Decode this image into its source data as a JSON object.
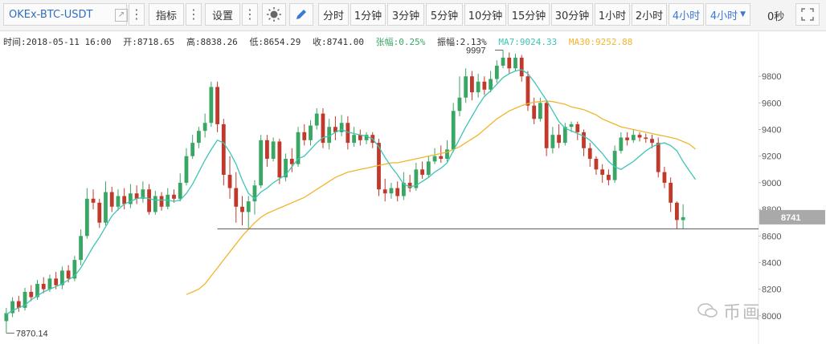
{
  "toolbar": {
    "symbol": "OKEx-BTC-USDT",
    "indicator_label": "指标",
    "settings_label": "设置",
    "intervals": [
      "分时",
      "1分钟",
      "3分钟",
      "5分钟",
      "10分钟",
      "15分钟",
      "30分钟",
      "1小时",
      "2小时",
      "4小时",
      "4小时"
    ],
    "active_interval": "4小时",
    "seconds_label": "0秒"
  },
  "info": {
    "time": "时间:2018-05-11 16:00",
    "open": "开:8718.65",
    "high": "高:8838.26",
    "low": "低:8654.29",
    "close": "收:8741.00",
    "change": "张幅:0.25%",
    "amplitude": "振幅:2.13%",
    "ma7": "MA7:9024.33",
    "ma30": "MA30:9252.88"
  },
  "colors": {
    "up": "#3aa663",
    "down": "#c0392b",
    "ma7": "#3fc5b5",
    "ma30": "#f3b42e",
    "active": "#3b78d6"
  },
  "watermark": "币画",
  "chart_data": {
    "type": "candlestick",
    "ylim": [
      7800,
      10000
    ],
    "yticks": [
      8000,
      8200,
      8400,
      8600,
      8800,
      9000,
      9200,
      9400,
      9600,
      9800
    ],
    "grid": false,
    "annotations": {
      "high_label": "9997",
      "low_label": "7870.14",
      "last_price": "8741"
    },
    "candles": [
      [
        7960,
        8020,
        7870,
        8060
      ],
      [
        8020,
        8110,
        7990,
        8140
      ],
      [
        8110,
        8060,
        8030,
        8150
      ],
      [
        8060,
        8180,
        8040,
        8210
      ],
      [
        8180,
        8140,
        8110,
        8230
      ],
      [
        8140,
        8240,
        8120,
        8270
      ],
      [
        8240,
        8200,
        8170,
        8290
      ],
      [
        8200,
        8280,
        8180,
        8310
      ],
      [
        8280,
        8230,
        8200,
        8330
      ],
      [
        8230,
        8340,
        8200,
        8370
      ],
      [
        8340,
        8280,
        8250,
        8380
      ],
      [
        8280,
        8420,
        8260,
        8450
      ],
      [
        8420,
        8600,
        8380,
        8650
      ],
      [
        8600,
        8880,
        8580,
        8960
      ],
      [
        8880,
        8850,
        8800,
        8950
      ],
      [
        8850,
        8700,
        8660,
        8880
      ],
      [
        8700,
        8930,
        8680,
        9010
      ],
      [
        8930,
        8820,
        8780,
        8970
      ],
      [
        8820,
        8900,
        8790,
        8950
      ],
      [
        8900,
        8840,
        8800,
        8960
      ],
      [
        8840,
        8920,
        8810,
        8990
      ],
      [
        8920,
        8880,
        8840,
        8980
      ],
      [
        8880,
        8950,
        8850,
        9010
      ],
      [
        8950,
        8780,
        8760,
        8990
      ],
      [
        8780,
        8900,
        8760,
        8940
      ],
      [
        8900,
        8820,
        8790,
        8930
      ],
      [
        8820,
        8910,
        8800,
        8960
      ],
      [
        8910,
        8880,
        8850,
        8950
      ],
      [
        8880,
        9000,
        8860,
        9070
      ],
      [
        9000,
        9200,
        8980,
        9260
      ],
      [
        9200,
        9300,
        9180,
        9360
      ],
      [
        9300,
        9390,
        9260,
        9420
      ],
      [
        9390,
        9450,
        9340,
        9520
      ],
      [
        9450,
        9720,
        9420,
        9760
      ],
      [
        9720,
        9440,
        9380,
        9760
      ],
      [
        9440,
        9060,
        8980,
        9480
      ],
      [
        9060,
        8960,
        8880,
        9200
      ],
      [
        8960,
        8820,
        8700,
        9080
      ],
      [
        8820,
        8780,
        8680,
        8900
      ],
      [
        8780,
        8860,
        8660,
        8900
      ],
      [
        8860,
        8980,
        8760,
        9020
      ],
      [
        8980,
        9320,
        8960,
        9360
      ],
      [
        9320,
        9180,
        9120,
        9360
      ],
      [
        9180,
        9310,
        9160,
        9340
      ],
      [
        9310,
        9040,
        8990,
        9330
      ],
      [
        9040,
        9180,
        9010,
        9220
      ],
      [
        9180,
        9140,
        9080,
        9260
      ],
      [
        9140,
        9380,
        9120,
        9420
      ],
      [
        9380,
        9320,
        9280,
        9440
      ],
      [
        9320,
        9430,
        9280,
        9470
      ],
      [
        9430,
        9520,
        9400,
        9560
      ],
      [
        9520,
        9300,
        9260,
        9560
      ],
      [
        9300,
        9420,
        9250,
        9480
      ],
      [
        9420,
        9380,
        9320,
        9500
      ],
      [
        9380,
        9450,
        9350,
        9510
      ],
      [
        9450,
        9300,
        9250,
        9500
      ],
      [
        9300,
        9360,
        9270,
        9420
      ],
      [
        9360,
        9320,
        9280,
        9400
      ],
      [
        9320,
        9360,
        9290,
        9380
      ],
      [
        9360,
        9300,
        9260,
        9380
      ],
      [
        9300,
        8950,
        8900,
        9330
      ],
      [
        8950,
        8920,
        8860,
        9030
      ],
      [
        8920,
        8960,
        8880,
        9000
      ],
      [
        8960,
        8900,
        8860,
        9010
      ],
      [
        8900,
        9000,
        8870,
        9080
      ],
      [
        9000,
        8960,
        8930,
        9060
      ],
      [
        8960,
        9100,
        8940,
        9150
      ],
      [
        9100,
        9060,
        9030,
        9160
      ],
      [
        9060,
        9160,
        9040,
        9200
      ],
      [
        9160,
        9200,
        9140,
        9260
      ],
      [
        9200,
        9180,
        9150,
        9280
      ],
      [
        9180,
        9250,
        9160,
        9320
      ],
      [
        9250,
        9540,
        9230,
        9600
      ],
      [
        9540,
        9640,
        9500,
        9800
      ],
      [
        9640,
        9800,
        9600,
        9860
      ],
      [
        9800,
        9680,
        9620,
        9840
      ],
      [
        9680,
        9760,
        9640,
        9820
      ],
      [
        9760,
        9700,
        9660,
        9800
      ],
      [
        9700,
        9780,
        9680,
        9840
      ],
      [
        9780,
        9880,
        9750,
        9920
      ],
      [
        9880,
        9940,
        9860,
        9997
      ],
      [
        9940,
        9860,
        9820,
        9980
      ],
      [
        9860,
        9940,
        9840,
        9970
      ],
      [
        9940,
        9800,
        9760,
        9960
      ],
      [
        9800,
        9580,
        9540,
        9840
      ],
      [
        9580,
        9480,
        9440,
        9640
      ],
      [
        9480,
        9600,
        9460,
        9640
      ],
      [
        9600,
        9260,
        9200,
        9620
      ],
      [
        9260,
        9360,
        9220,
        9420
      ],
      [
        9360,
        9300,
        9260,
        9440
      ],
      [
        9300,
        9420,
        9280,
        9450
      ],
      [
        9420,
        9440,
        9380,
        9460
      ],
      [
        9440,
        9380,
        9320,
        9460
      ],
      [
        9380,
        9260,
        9200,
        9400
      ],
      [
        9260,
        9180,
        9120,
        9300
      ],
      [
        9180,
        9100,
        9060,
        9200
      ],
      [
        9100,
        9060,
        9000,
        9140
      ],
      [
        9060,
        9020,
        8980,
        9100
      ],
      [
        9020,
        9240,
        9000,
        9280
      ],
      [
        9240,
        9340,
        9220,
        9380
      ],
      [
        9340,
        9320,
        9280,
        9380
      ],
      [
        9320,
        9360,
        9300,
        9400
      ],
      [
        9360,
        9340,
        9310,
        9380
      ],
      [
        9340,
        9330,
        9300,
        9370
      ],
      [
        9330,
        9300,
        9260,
        9360
      ],
      [
        9300,
        9080,
        9040,
        9340
      ],
      [
        9080,
        9000,
        8960,
        9120
      ],
      [
        9000,
        8850,
        8780,
        9040
      ],
      [
        8850,
        8720,
        8654,
        8860
      ],
      [
        8719,
        8741,
        8654,
        8838
      ]
    ],
    "ma7": [
      8010,
      8040,
      8060,
      8080,
      8120,
      8150,
      8180,
      8200,
      8220,
      8240,
      8270,
      8300,
      8360,
      8440,
      8520,
      8590,
      8670,
      8750,
      8800,
      8840,
      8860,
      8880,
      8890,
      8880,
      8870,
      8870,
      8870,
      8860,
      8870,
      8920,
      8990,
      9080,
      9170,
      9250,
      9320,
      9300,
      9230,
      9140,
      9020,
      8920,
      8880,
      8930,
      8960,
      9000,
      9030,
      9060,
      9120,
      9180,
      9200,
      9250,
      9300,
      9340,
      9350,
      9380,
      9400,
      9380,
      9370,
      9360,
      9350,
      9330,
      9270,
      9190,
      9120,
      9060,
      8990,
      8970,
      8980,
      9010,
      9040,
      9080,
      9110,
      9150,
      9240,
      9330,
      9420,
      9500,
      9580,
      9650,
      9690,
      9740,
      9790,
      9820,
      9840,
      9850,
      9820,
      9760,
      9690,
      9620,
      9540,
      9460,
      9410,
      9390,
      9370,
      9350,
      9320,
      9270,
      9220,
      9160,
      9120,
      9100,
      9130,
      9160,
      9200,
      9240,
      9270,
      9290,
      9300,
      9280,
      9240,
      9160,
      9090,
      9024.33
    ],
    "ma30": [
      null,
      null,
      null,
      null,
      null,
      null,
      null,
      null,
      null,
      null,
      null,
      null,
      null,
      null,
      null,
      null,
      null,
      null,
      null,
      null,
      null,
      null,
      null,
      null,
      null,
      null,
      null,
      null,
      null,
      8160,
      8180,
      8200,
      8240,
      8300,
      8360,
      8420,
      8480,
      8540,
      8600,
      8650,
      8700,
      8740,
      8770,
      8790,
      8810,
      8830,
      8850,
      8870,
      8890,
      8920,
      8950,
      8980,
      9010,
      9040,
      9060,
      9080,
      9090,
      9100,
      9110,
      9120,
      9130,
      9140,
      9150,
      9150,
      9160,
      9170,
      9180,
      9190,
      9200,
      9210,
      9220,
      9230,
      9250,
      9270,
      9300,
      9330,
      9360,
      9400,
      9440,
      9480,
      9510,
      9540,
      9560,
      9580,
      9595,
      9605,
      9610,
      9615,
      9610,
      9600,
      9590,
      9570,
      9560,
      9550,
      9530,
      9510,
      9480,
      9460,
      9440,
      9420,
      9410,
      9400,
      9390,
      9380,
      9370,
      9360,
      9350,
      9340,
      9330,
      9310,
      9290,
      9252.88
    ]
  }
}
